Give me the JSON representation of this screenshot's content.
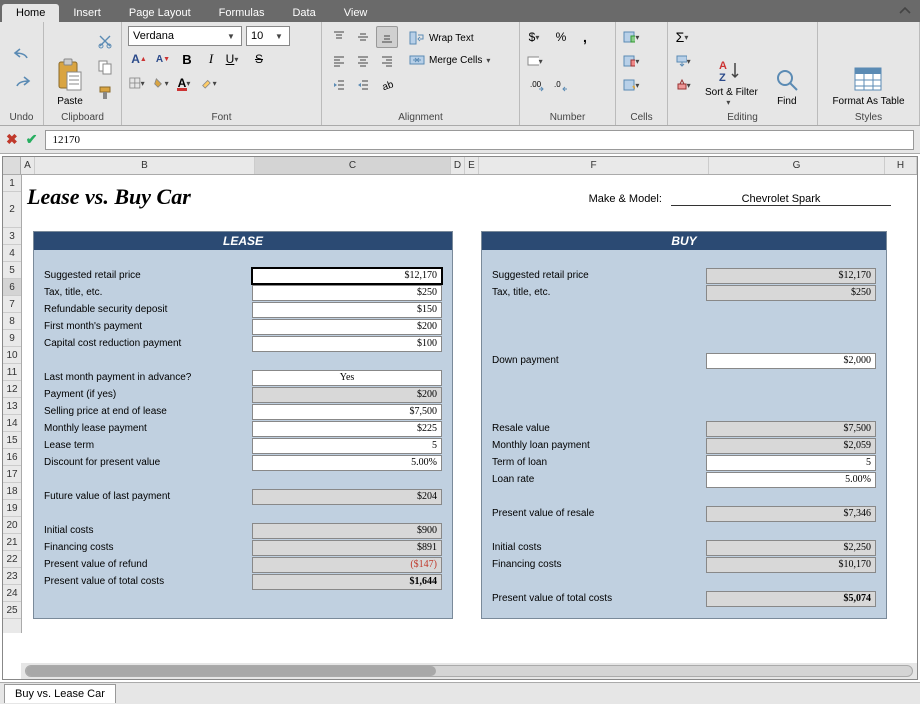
{
  "tabs": {
    "t0": "Home",
    "t1": "Insert",
    "t2": "Page Layout",
    "t3": "Formulas",
    "t4": "Data",
    "t5": "View"
  },
  "ribbon": {
    "undo": "Undo",
    "clipboard": {
      "label": "Clipboard",
      "paste": "Paste"
    },
    "font": {
      "label": "Font",
      "name": "Verdana",
      "size": "10"
    },
    "alignment": {
      "label": "Alignment",
      "wrap": "Wrap Text",
      "merge": "Merge Cells"
    },
    "number": {
      "label": "Number"
    },
    "cells": {
      "label": "Cells"
    },
    "editing": {
      "label": "Editing",
      "sort": "Sort & Filter",
      "find": "Find"
    },
    "styles": {
      "label": "Styles",
      "format": "Format As Table"
    }
  },
  "formula_value": "12170",
  "columns": [
    "A",
    "B",
    "C",
    "D",
    "E",
    "F",
    "G",
    "H"
  ],
  "title": "Lease vs. Buy Car",
  "make_model_label": "Make & Model:",
  "make_model_value": "Chevrolet Spark",
  "lease": {
    "header": "LEASE",
    "rows": {
      "srp": {
        "label": "Suggested retail price",
        "value": "$12,170"
      },
      "tax": {
        "label": "Tax, title, etc.",
        "value": "$250"
      },
      "deposit": {
        "label": "Refundable security deposit",
        "value": "$150"
      },
      "first": {
        "label": "First month's payment",
        "value": "$200"
      },
      "capital": {
        "label": "Capital cost reduction payment",
        "value": "$100"
      },
      "lastq": {
        "label": "Last month payment in advance?",
        "value": "Yes"
      },
      "payifyes": {
        "label": "Payment (if yes)",
        "value": "$200"
      },
      "sellend": {
        "label": "Selling price at end of lease",
        "value": "$7,500"
      },
      "monthly": {
        "label": "Monthly lease payment",
        "value": "$225"
      },
      "term": {
        "label": "Lease term",
        "value": "5"
      },
      "discount": {
        "label": "Discount for present value",
        "value": "5.00%"
      },
      "future": {
        "label": "Future value of last payment",
        "value": "$204"
      },
      "initcost": {
        "label": "Initial costs",
        "value": "$900"
      },
      "fincost": {
        "label": "Financing costs",
        "value": "$891"
      },
      "refund": {
        "label": "Present value of refund",
        "value": "($147)"
      },
      "total": {
        "label": "Present value of total costs",
        "value": "$1,644"
      }
    }
  },
  "buy": {
    "header": "BUY",
    "rows": {
      "srp": {
        "label": "Suggested retail price",
        "value": "$12,170"
      },
      "tax": {
        "label": "Tax, title, etc.",
        "value": "$250"
      },
      "down": {
        "label": "Down payment",
        "value": "$2,000"
      },
      "resale": {
        "label": "Resale value",
        "value": "$7,500"
      },
      "monthly": {
        "label": "Monthly loan payment",
        "value": "$2,059"
      },
      "term": {
        "label": "Term of loan",
        "value": "5"
      },
      "rate": {
        "label": "Loan rate",
        "value": "5.00%"
      },
      "pvresale": {
        "label": "Present value of resale",
        "value": "$7,346"
      },
      "initcost": {
        "label": "Initial costs",
        "value": "$2,250"
      },
      "fincost": {
        "label": "Financing costs",
        "value": "$10,170"
      },
      "total": {
        "label": "Present value of total costs",
        "value": "$5,074"
      }
    }
  },
  "sheet_tab": "Buy vs. Lease Car"
}
